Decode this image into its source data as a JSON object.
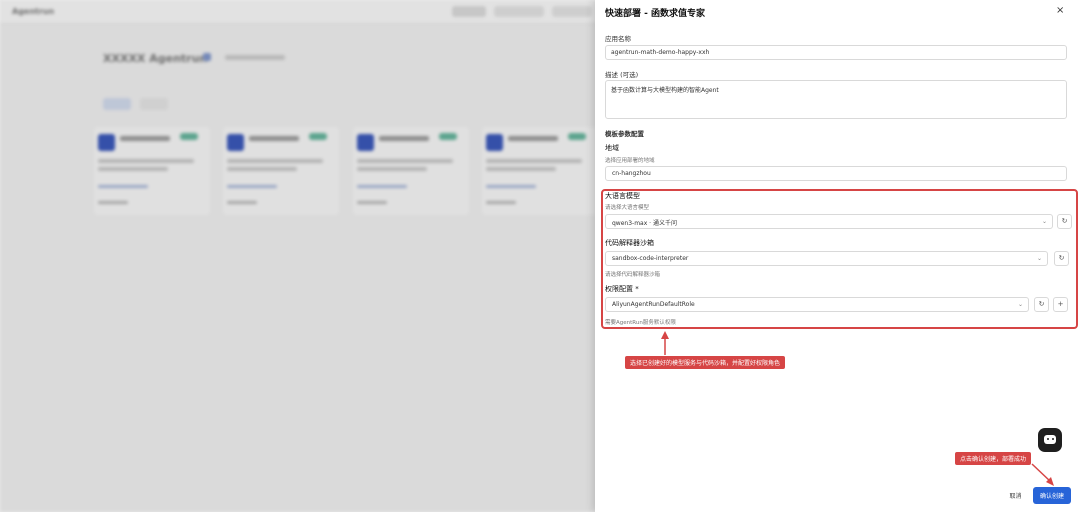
{
  "background": {
    "app_name": "Agentrun",
    "page_heading": "XXXXX Agentrun",
    "nav_items": [
      "",
      "",
      ""
    ]
  },
  "drawer": {
    "title": "快速部署 - 函数求值专家",
    "fields": {
      "name_label": "应用名称",
      "name_value": "agentrun-math-demo-happy-xxh",
      "description_label": "描述 (可选)",
      "description_value": "基于函数计算与大模型构建的智能Agent"
    },
    "template_config": {
      "section_title": "模板参数配置",
      "region": {
        "label": "地域",
        "hint": "选择应用部署的地域",
        "value": "cn-hangzhou"
      },
      "model_service": {
        "label": "大语言模型",
        "hint": "请选择大语言模型",
        "value": "qwen3-max · 通义千问"
      },
      "sandbox": {
        "label": "代码解释器沙箱",
        "value": "sandbox-code-interpreter",
        "hint": "请选择代码解释器沙箱"
      },
      "role": {
        "label": "权限配置 *",
        "value": "AliyunAgentRunDefaultRole",
        "hint": "需要AgentRun服务默认权限"
      }
    },
    "annotations": {
      "config_callout": "选择已创建好的模型服务与代码沙箱，并配置好权限角色",
      "confirm_callout": "点击确认创建，部署成功"
    },
    "footer": {
      "cancel_label": "取消",
      "confirm_label": "确认创建"
    }
  },
  "icons": {
    "close": "×",
    "chevron": "⌄",
    "refresh": "↻",
    "add": "+"
  },
  "colors": {
    "primary": "#2764d8",
    "annotation_red": "#d64545",
    "chat_fab": "#1f1f1f"
  }
}
